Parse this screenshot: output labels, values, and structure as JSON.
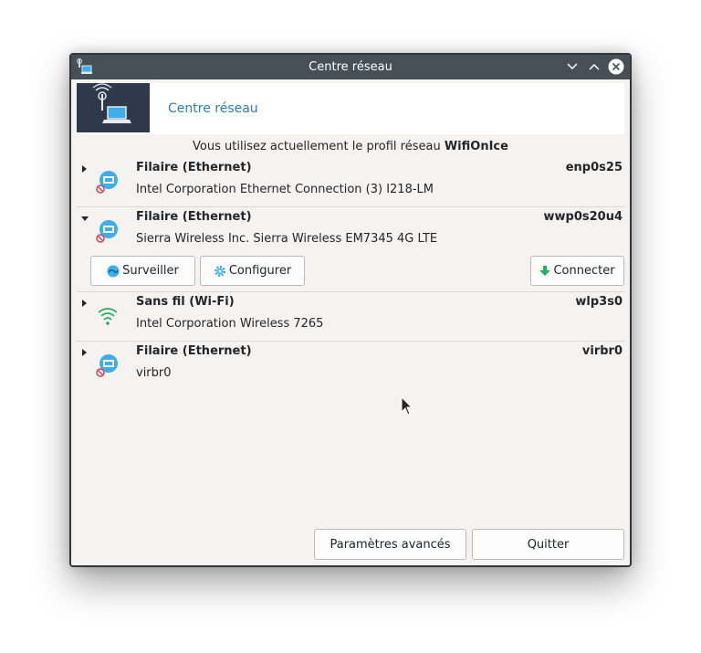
{
  "window": {
    "title": "Centre réseau"
  },
  "header": {
    "link_text": "Centre réseau"
  },
  "profile": {
    "prefix": "Vous utilisez actuellement le profil réseau ",
    "name": "WifiOnIce"
  },
  "connections": [
    {
      "type": "Filaire (Ethernet)",
      "interface": "enp0s25",
      "device": "Intel Corporation Ethernet Connection (3) I218-LM",
      "expanded": false,
      "icon": "ethernet-disconnected-icon"
    },
    {
      "type": "Filaire (Ethernet)",
      "interface": "wwp0s20u4",
      "device": "Sierra Wireless Inc. Sierra Wireless EM7345 4G LTE",
      "expanded": true,
      "icon": "ethernet-disconnected-icon",
      "actions": {
        "monitor": "Surveiller",
        "configure": "Configurer",
        "connect": "Connecter"
      }
    },
    {
      "type": "Sans fil (Wi-Fi)",
      "interface": "wlp3s0",
      "device": "Intel Corporation Wireless 7265",
      "expanded": false,
      "icon": "wifi-icon"
    },
    {
      "type": "Filaire (Ethernet)",
      "interface": "virbr0",
      "device": "virbr0",
      "expanded": false,
      "icon": "ethernet-disconnected-icon"
    }
  ],
  "footer": {
    "advanced": "Paramètres avancés",
    "quit": "Quitter"
  },
  "colors": {
    "titlebar": "#475057",
    "link": "#2980b9",
    "banner": "#2e3a4c",
    "connect_arrow": "#27ae60",
    "wifi": "#27ae60",
    "ethernet_icon": "#3daee9",
    "disconnected_badge": "#da4453"
  }
}
